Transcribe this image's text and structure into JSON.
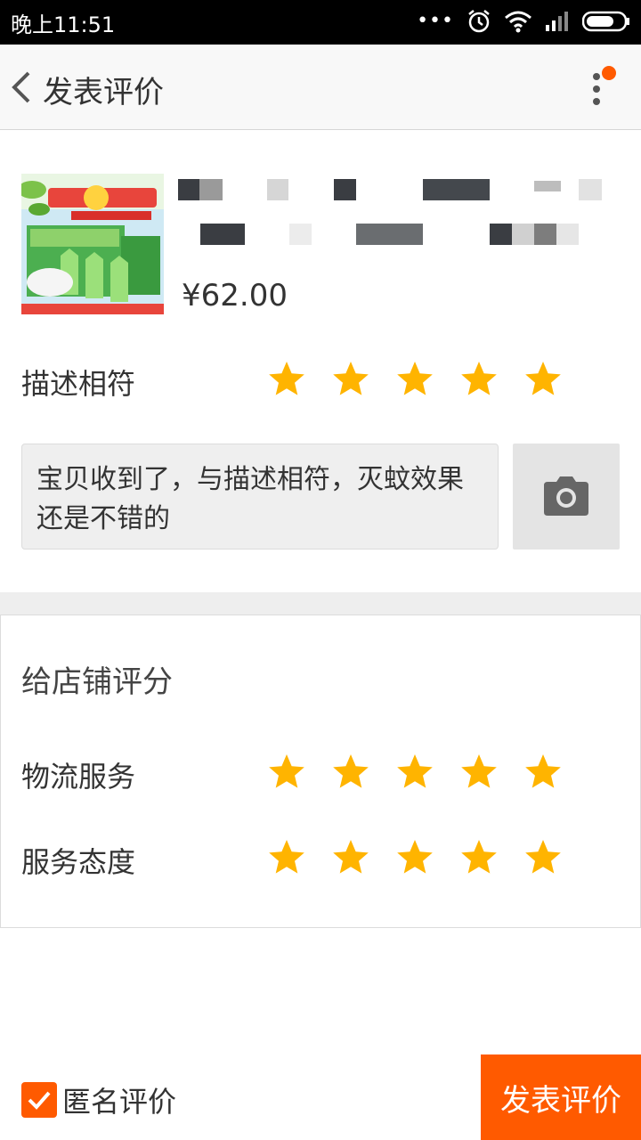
{
  "status_bar": {
    "time": "晚上11:51",
    "more": "•••"
  },
  "header": {
    "title": "发表评价"
  },
  "product": {
    "price": "¥62.00"
  },
  "description_rating": {
    "label": "描述相符",
    "stars": 5
  },
  "comment": {
    "text": "宝贝收到了，与描述相符，灭蚊效果还是不错的"
  },
  "shop_rating": {
    "title": "给店铺评分",
    "items": [
      {
        "label": "物流服务",
        "stars": 5
      },
      {
        "label": "服务态度",
        "stars": 5
      }
    ]
  },
  "footer": {
    "anonymous_label": "匿名评价",
    "anonymous_checked": true,
    "submit_label": "发表评价"
  },
  "colors": {
    "accent": "#ff5a00",
    "star": "#ffb400"
  }
}
